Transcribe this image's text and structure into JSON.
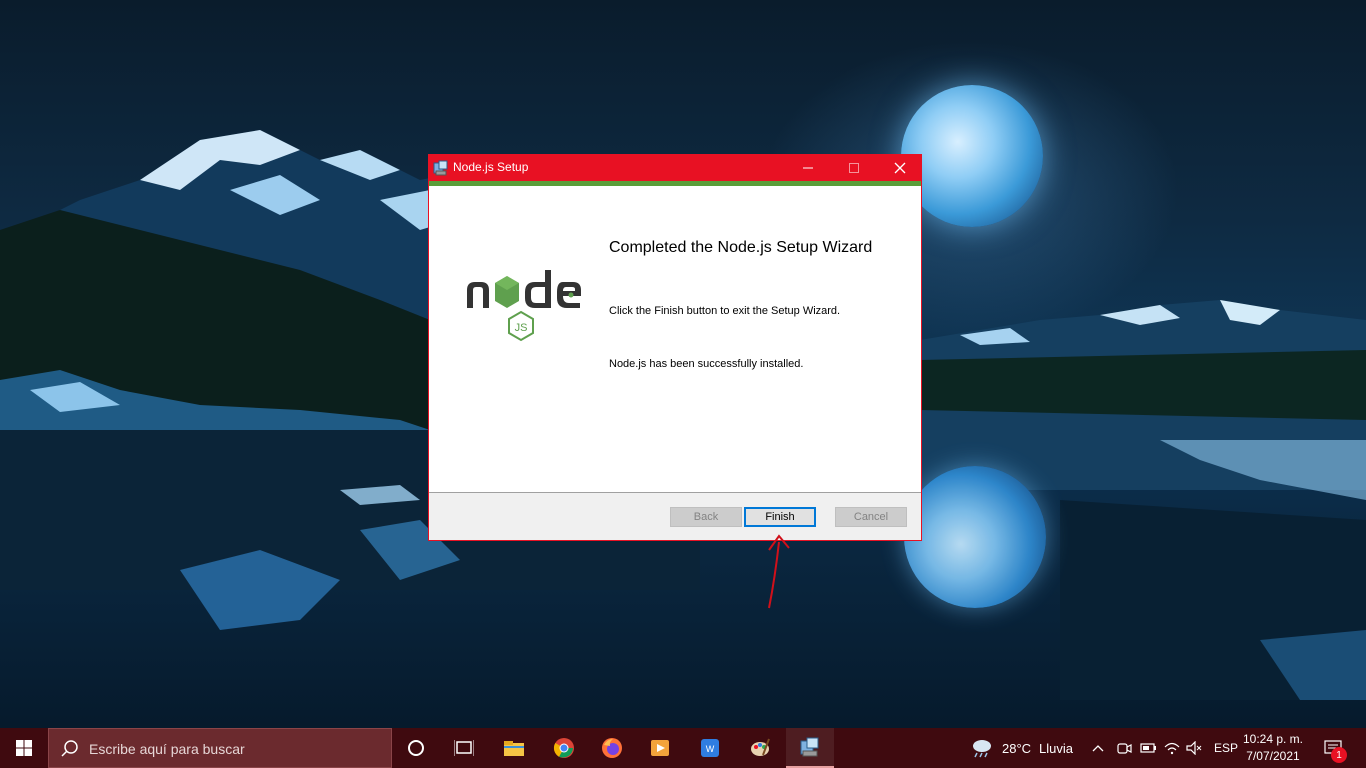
{
  "dialog": {
    "title": "Node.js Setup",
    "heading": "Completed the Node.js Setup Wizard",
    "message1": "Click the Finish button to exit the Setup Wizard.",
    "message2": "Node.js has been successfully installed.",
    "logo_text": "node",
    "logo_sub": "JS",
    "buttons": {
      "back": "Back",
      "finish": "Finish",
      "cancel": "Cancel"
    },
    "colors": {
      "titlebar": "#e81123",
      "accent_bar": "#5a9e3a",
      "logo_dark": "#333333",
      "logo_green": "#5fa04e"
    }
  },
  "taskbar": {
    "search_placeholder": "Escribe aquí para buscar",
    "pinned": [
      "cortana-icon",
      "task-view-icon",
      "file-explorer-icon",
      "chrome-icon",
      "firefox-icon",
      "media-player-icon",
      "wps-office-icon",
      "paint-icon",
      "nodejs-setup-icon"
    ],
    "weather": {
      "temp": "28°C",
      "condition": "Lluvia"
    },
    "language": "ESP",
    "time": "10:24 p. m.",
    "date": "7/07/2021",
    "notification_count": "1",
    "color": "#3f0a0f"
  },
  "annotation": {
    "type": "red-arrow",
    "color": "#d0101a"
  }
}
